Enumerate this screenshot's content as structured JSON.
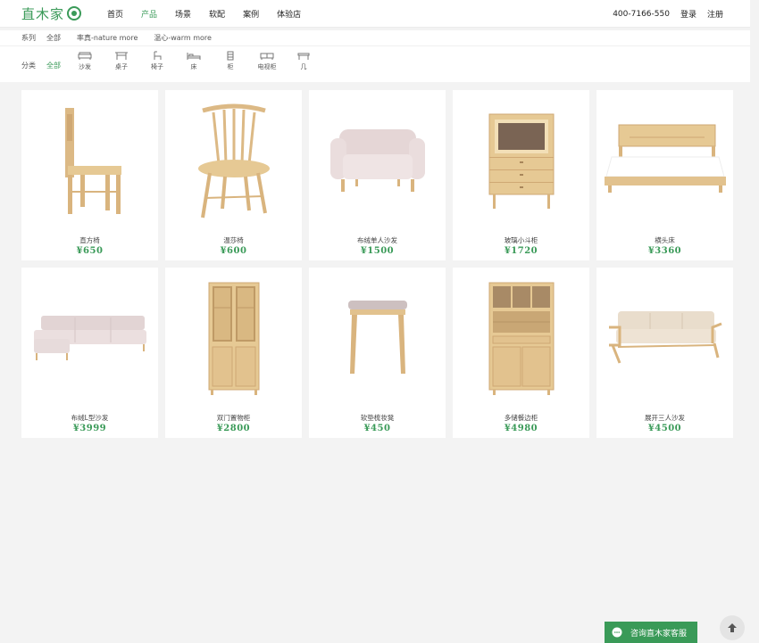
{
  "header": {
    "logo_text": "直木家",
    "nav": [
      {
        "label": "首页",
        "active": false
      },
      {
        "label": "产品",
        "active": true
      },
      {
        "label": "场景",
        "active": false
      },
      {
        "label": "软配",
        "active": false
      },
      {
        "label": "案例",
        "active": false
      },
      {
        "label": "体验店",
        "active": false
      }
    ],
    "phone": "400-7166-550",
    "login": "登录",
    "register": "注册"
  },
  "filters": {
    "series_label": "系列",
    "series_options": [
      "全部",
      "率真-nature more",
      "温心-warm more"
    ],
    "category_label": "分类",
    "category_all": "全部",
    "categories": [
      {
        "label": "沙发",
        "icon": "sofa-icon"
      },
      {
        "label": "桌子",
        "icon": "table-icon"
      },
      {
        "label": "椅子",
        "icon": "chair-icon"
      },
      {
        "label": "床",
        "icon": "bed-icon"
      },
      {
        "label": "柜",
        "icon": "cabinet-icon"
      },
      {
        "label": "电视柜",
        "icon": "tv-cabinet-icon"
      },
      {
        "label": "几",
        "icon": "side-table-icon"
      }
    ]
  },
  "products": [
    {
      "name": "直方椅",
      "price": "¥650",
      "icon": "chair-image"
    },
    {
      "name": "温莎椅",
      "price": "¥600",
      "icon": "windsor-chair-image"
    },
    {
      "name": "布绒单人沙发",
      "price": "¥1500",
      "icon": "armchair-image"
    },
    {
      "name": "玻璃小斗柜",
      "price": "¥1720",
      "icon": "glass-cabinet-image"
    },
    {
      "name": "横头床",
      "price": "¥3360",
      "icon": "bed-image"
    },
    {
      "name": "布绒L型沙发",
      "price": "¥3999",
      "icon": "l-sofa-image"
    },
    {
      "name": "双门置物柜",
      "price": "¥2800",
      "icon": "bookcase-image"
    },
    {
      "name": "软垫梳妆凳",
      "price": "¥450",
      "icon": "stool-image"
    },
    {
      "name": "多储餐边柜",
      "price": "¥4980",
      "icon": "sideboard-image"
    },
    {
      "name": "展开三人沙发",
      "price": "¥4500",
      "icon": "three-seat-sofa-image"
    }
  ],
  "chat": {
    "label": "咨询直木家客服"
  },
  "colors": {
    "accent": "#3a9a58",
    "wood": "#e2c28e",
    "fabric": "#e8dcdc"
  }
}
